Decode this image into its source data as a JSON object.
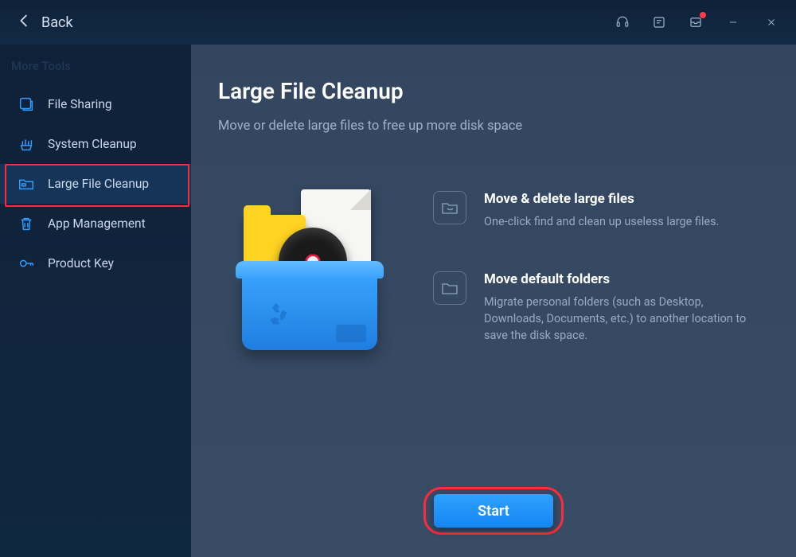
{
  "titlebar": {
    "back_label": "Back"
  },
  "sidebar": {
    "section_label": "More Tools",
    "items": [
      {
        "id": "file-sharing",
        "label": "File Sharing"
      },
      {
        "id": "system-cleanup",
        "label": "System Cleanup"
      },
      {
        "id": "large-file-cleanup",
        "label": "Large File Cleanup"
      },
      {
        "id": "app-management",
        "label": "App Management"
      },
      {
        "id": "product-key",
        "label": "Product Key"
      }
    ],
    "active_index": 2
  },
  "main": {
    "title": "Large File Cleanup",
    "subtitle": "Move or delete large files to free up more disk space",
    "features": [
      {
        "title": "Move & delete large files",
        "desc": "One-click find and clean up useless large files."
      },
      {
        "title": "Move default folders",
        "desc": "Migrate personal folders (such as Desktop, Downloads, Documents, etc.) to another location to save the disk space."
      }
    ],
    "start_label": "Start"
  },
  "toolbar_has_notification": true
}
